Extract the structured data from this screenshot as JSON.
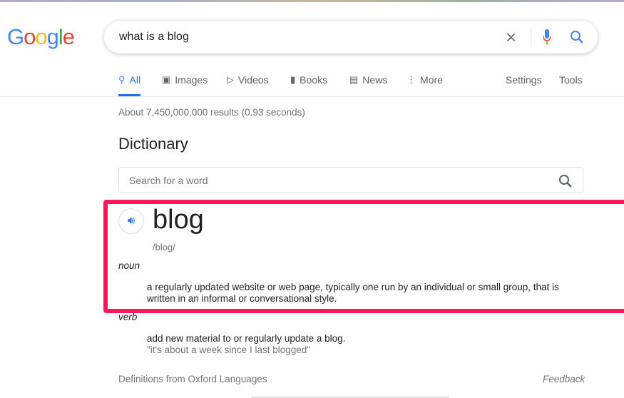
{
  "logo": "Google",
  "search": {
    "query": "what is a blog"
  },
  "tabs": [
    {
      "label": "All",
      "icon": "search-icon",
      "active": true
    },
    {
      "label": "Images",
      "icon": "image-icon"
    },
    {
      "label": "Videos",
      "icon": "play-icon"
    },
    {
      "label": "Books",
      "icon": "book-icon"
    },
    {
      "label": "News",
      "icon": "news-icon"
    },
    {
      "label": "More",
      "icon": "more-vert-icon"
    }
  ],
  "tools": {
    "settings": "Settings",
    "tools": "Tools"
  },
  "stats": "About 7,450,000,000 results (0.93 seconds)",
  "dictionary": {
    "title": "Dictionary",
    "placeholder": "Search for a word",
    "word": "blog",
    "phonetic": "/blog/",
    "noun": {
      "pos": "noun",
      "definition": "a regularly updated website or web page, typically one run by an individual or small group, that is written in an informal or conversational style."
    },
    "verb": {
      "pos": "verb",
      "definition": "add new material to or regularly update a blog.",
      "example": "\"it's about a week since I last blogged\""
    },
    "source": "Definitions from Oxford Languages",
    "feedback": "Feedback"
  },
  "colors": {
    "accent": "#1a73e8",
    "highlight": "#ff1759"
  }
}
